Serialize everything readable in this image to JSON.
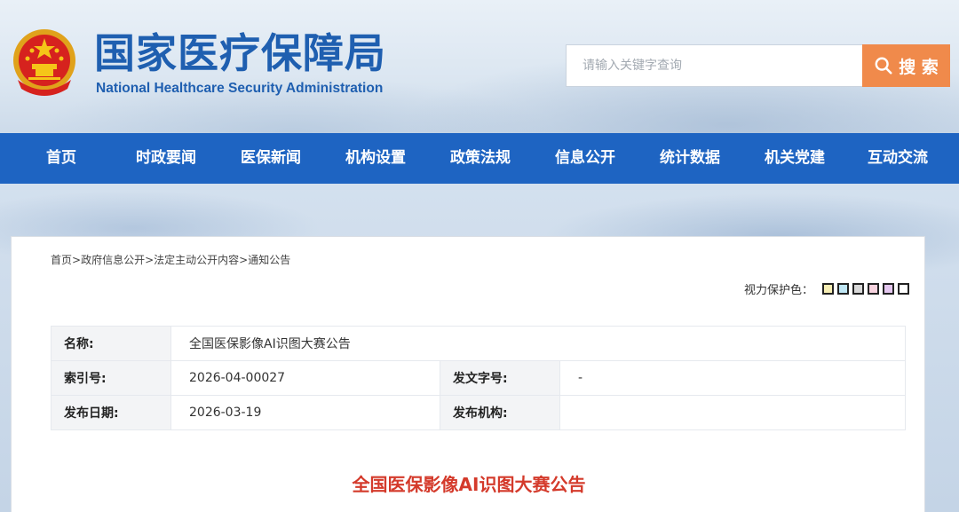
{
  "header": {
    "logo_cn": "国家医疗保障局",
    "logo_en": "National Healthcare Security Administration",
    "search": {
      "placeholder": "请输入关键字查询",
      "button_label": "搜 索"
    }
  },
  "nav": {
    "items": [
      "首页",
      "时政要闻",
      "医保新闻",
      "机构设置",
      "政策法规",
      "信息公开",
      "统计数据",
      "机关党建",
      "互动交流"
    ]
  },
  "breadcrumb": [
    "首页>",
    "政府信息公开>",
    "法定主动公开内容>",
    "通知公告"
  ],
  "eye_protect": {
    "label": "视力保护色：",
    "swatches": [
      "#f6eeb4",
      "#bfe6f4",
      "#d9d9d9",
      "#f7d3df",
      "#e4c7ef",
      "#ffffff"
    ]
  },
  "info": {
    "name_label": "名称:",
    "name_value": "全国医保影像AI识图大赛公告",
    "index_label": "索引号:",
    "index_value": "2026-04-00027",
    "docno_label": "发文字号:",
    "docno_value": "-",
    "date_label": "发布日期:",
    "date_value": "2026-03-19",
    "org_label": "发布机构:",
    "org_value": ""
  },
  "article": {
    "title": "全国医保影像AI识图大赛公告"
  },
  "colors": {
    "brand_blue": "#1e64c2",
    "logo_blue": "#1f5fb0",
    "search_orange": "#f08a4b",
    "title_red": "#d43a2b"
  }
}
